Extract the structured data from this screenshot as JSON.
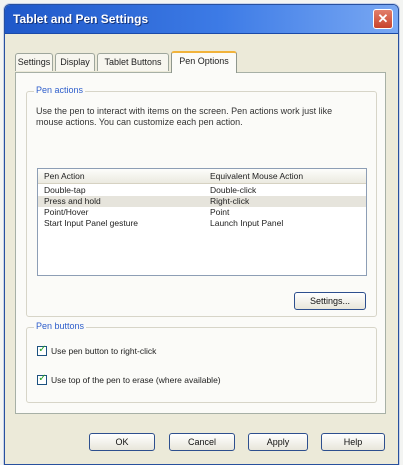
{
  "window": {
    "title": "Tablet and Pen Settings"
  },
  "tabs": [
    {
      "label": "Settings"
    },
    {
      "label": "Display"
    },
    {
      "label": "Tablet Buttons"
    },
    {
      "label": "Pen Options"
    }
  ],
  "pen_actions": {
    "group_label": "Pen actions",
    "description": "Use the pen to interact with items on the screen. Pen actions work just like mouse actions. You can customize each pen action.",
    "columns": [
      "Pen Action",
      "Equivalent Mouse Action"
    ],
    "rows": [
      {
        "action": "Double-tap",
        "mouse": "Double-click"
      },
      {
        "action": "Press and hold",
        "mouse": "Right-click"
      },
      {
        "action": "Point/Hover",
        "mouse": "Point"
      },
      {
        "action": "Start Input Panel gesture",
        "mouse": "Launch Input Panel"
      }
    ],
    "settings_button": "Settings..."
  },
  "pen_buttons": {
    "group_label": "Pen buttons",
    "options": [
      {
        "label": "Use pen button to right-click",
        "checked": true
      },
      {
        "label": "Use top of the pen to erase (where available)",
        "checked": true
      }
    ]
  },
  "footer": {
    "ok": "OK",
    "cancel": "Cancel",
    "apply": "Apply",
    "help": "Help"
  }
}
